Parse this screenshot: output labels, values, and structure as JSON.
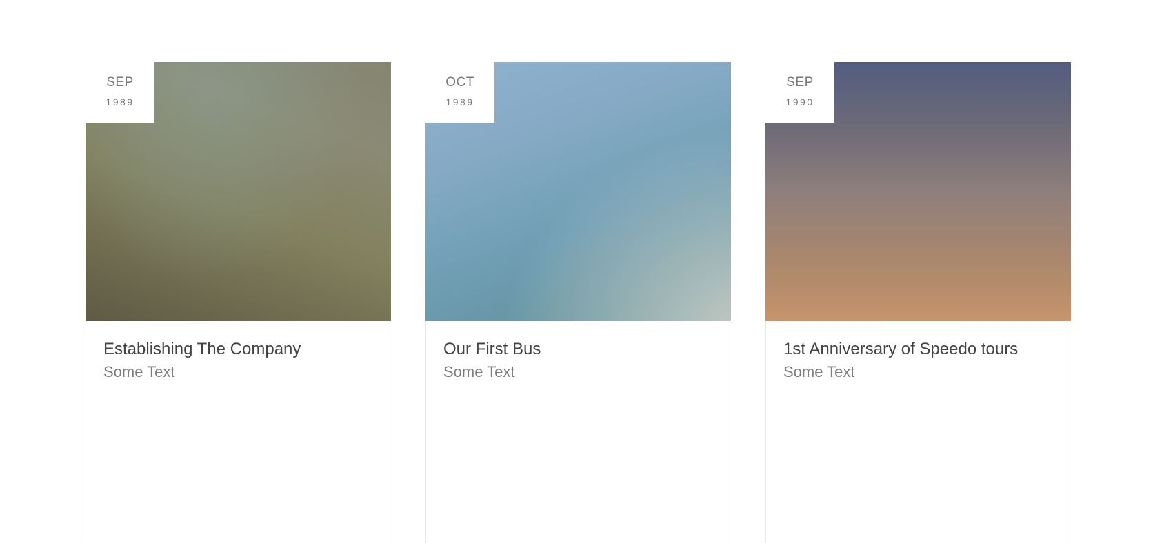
{
  "timeline": {
    "cards": [
      {
        "month": "SEP",
        "year": "1989",
        "title": "Establishing The Company",
        "text": "Some Text"
      },
      {
        "month": "OCT",
        "year": "1989",
        "title": "Our First Bus",
        "text": "Some Text"
      },
      {
        "month": "SEP",
        "year": "1990",
        "title": "1st Anniversary of Speedo tours",
        "text": "Some Text"
      }
    ]
  },
  "colors": {
    "title_text": "#444444",
    "muted_text": "#7d7d7d",
    "card_border": "#e6e6e6"
  }
}
